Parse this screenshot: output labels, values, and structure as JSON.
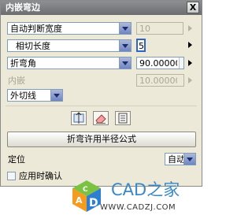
{
  "window": {
    "title": "内嵌弯边",
    "close_label": "X"
  },
  "form": {
    "width_mode": "自动判断宽度",
    "width_value": "10",
    "length_type": "相切长度",
    "length_value": "5",
    "angle_label": "折弯角",
    "angle_value": "90.00000",
    "inset_label": "内嵌",
    "inset_value": "10.00000",
    "tangent_mode": "外切线"
  },
  "toolbar": {
    "icons": [
      "bend-param-icon",
      "eraser-icon",
      "list-icon"
    ]
  },
  "bend_formula_button": "折弯许用半径公式",
  "position": {
    "label": "定位",
    "value": "自动"
  },
  "apply_confirm": {
    "label": "应用时确认",
    "checked": false
  },
  "watermark": {
    "brand": "CAD之家",
    "url": "WWW.CADZJ.COM",
    "colors": {
      "blue": "#2f7fd0",
      "green": "#7cc242",
      "orange": "#f39c1f"
    }
  }
}
